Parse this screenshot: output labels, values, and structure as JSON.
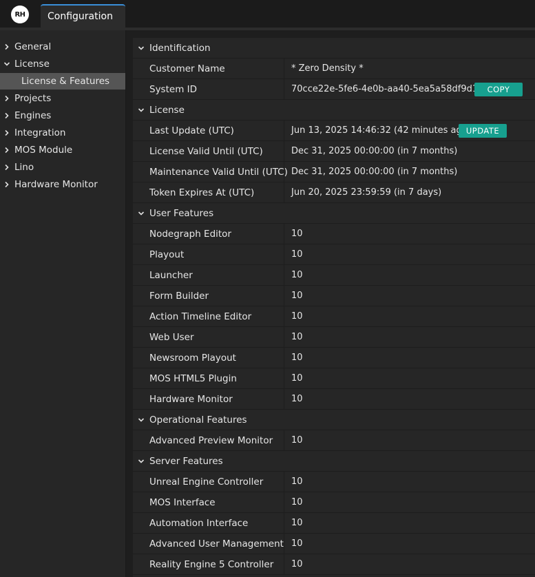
{
  "app": {
    "logo_text": "RH",
    "tab_label": "Configuration"
  },
  "colors": {
    "accent_tab": "#3a8fd9",
    "button": "#17a08f",
    "sidebar_active": "#555555"
  },
  "sidebar": {
    "items": [
      {
        "label": "General",
        "expanded": false
      },
      {
        "label": "License",
        "expanded": true
      },
      {
        "label": "License & Features",
        "sub": true,
        "active": true
      },
      {
        "label": "Projects",
        "expanded": false
      },
      {
        "label": "Engines",
        "expanded": false
      },
      {
        "label": "Integration",
        "expanded": false
      },
      {
        "label": "MOS Module",
        "expanded": false
      },
      {
        "label": "Lino",
        "expanded": false
      },
      {
        "label": "Hardware Monitor",
        "expanded": false
      }
    ]
  },
  "main": {
    "sections": [
      {
        "title": "Identification",
        "fields": [
          {
            "key": "Customer Name",
            "value": "* Zero Density *"
          },
          {
            "key": "System ID",
            "value": "70cce22e-5fe6-4e0b-aa40-5ea5a58df9d1",
            "button": "COPY"
          }
        ]
      },
      {
        "title": "License",
        "fields": [
          {
            "key": "Last Update (UTC)",
            "value": "Jun 13, 2025 14:46:32 (42 minutes ago)",
            "button": "UPDATE"
          },
          {
            "key": "License Valid Until (UTC)",
            "value": "Dec 31, 2025 00:00:00 (in 7 months)"
          },
          {
            "key": "Maintenance Valid Until (UTC)",
            "value": "Dec 31, 2025 00:00:00 (in 7 months)"
          },
          {
            "key": "Token Expires At (UTC)",
            "value": "Jun 20, 2025 23:59:59 (in 7 days)"
          }
        ]
      },
      {
        "title": "User Features",
        "fields": [
          {
            "key": "Nodegraph Editor",
            "value": "10"
          },
          {
            "key": "Playout",
            "value": "10"
          },
          {
            "key": "Launcher",
            "value": "10"
          },
          {
            "key": "Form Builder",
            "value": "10"
          },
          {
            "key": "Action Timeline Editor",
            "value": "10"
          },
          {
            "key": "Web User",
            "value": "10"
          },
          {
            "key": "Newsroom Playout",
            "value": "10"
          },
          {
            "key": "MOS HTML5 Plugin",
            "value": "10"
          },
          {
            "key": "Hardware Monitor",
            "value": "10"
          }
        ]
      },
      {
        "title": "Operational Features",
        "fields": [
          {
            "key": "Advanced Preview Monitor",
            "value": "10"
          }
        ]
      },
      {
        "title": "Server Features",
        "fields": [
          {
            "key": "Unreal Engine Controller",
            "value": "10"
          },
          {
            "key": "MOS Interface",
            "value": "10"
          },
          {
            "key": "Automation Interface",
            "value": "10"
          },
          {
            "key": "Advanced User Management",
            "value": "10"
          },
          {
            "key": "Reality Engine 5 Controller",
            "value": "10"
          }
        ]
      }
    ]
  }
}
